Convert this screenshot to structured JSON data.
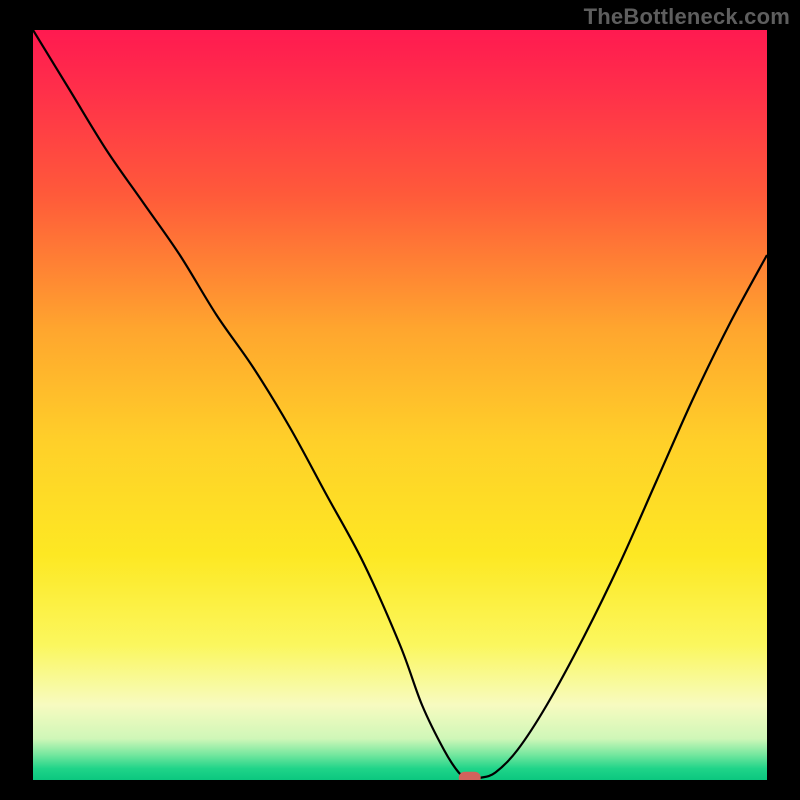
{
  "watermark": "TheBottleneck.com",
  "chart_data": {
    "type": "line",
    "title": "",
    "xlabel": "",
    "ylabel": "",
    "xlim": [
      0,
      100
    ],
    "ylim": [
      0,
      100
    ],
    "gradient_stops": [
      {
        "offset": 0,
        "color": "#ff1a50"
      },
      {
        "offset": 0.08,
        "color": "#ff2f4a"
      },
      {
        "offset": 0.22,
        "color": "#ff5a3a"
      },
      {
        "offset": 0.4,
        "color": "#ffa62e"
      },
      {
        "offset": 0.55,
        "color": "#ffd029"
      },
      {
        "offset": 0.7,
        "color": "#fde823"
      },
      {
        "offset": 0.82,
        "color": "#fbf75e"
      },
      {
        "offset": 0.9,
        "color": "#f7fbc0"
      },
      {
        "offset": 0.945,
        "color": "#cff7b8"
      },
      {
        "offset": 0.965,
        "color": "#7ae8a0"
      },
      {
        "offset": 0.985,
        "color": "#1fd489"
      },
      {
        "offset": 1.0,
        "color": "#0bc77f"
      }
    ],
    "series": [
      {
        "name": "bottleneck-curve",
        "x": [
          0,
          5,
          10,
          15,
          20,
          25,
          30,
          35,
          40,
          45,
          50,
          53,
          56,
          58,
          59,
          60,
          61,
          63,
          66,
          70,
          75,
          80,
          85,
          90,
          95,
          100
        ],
        "y": [
          100,
          92,
          84,
          77,
          70,
          62,
          55,
          47,
          38,
          29,
          18,
          10,
          4,
          1,
          0.5,
          0.3,
          0.3,
          1,
          4,
          10,
          19,
          29,
          40,
          51,
          61,
          70
        ]
      }
    ],
    "marker": {
      "x": 59.5,
      "y": 0.3
    },
    "colors": {
      "curve": "#000000",
      "marker": "#d2635c",
      "frame": "#000000"
    }
  }
}
